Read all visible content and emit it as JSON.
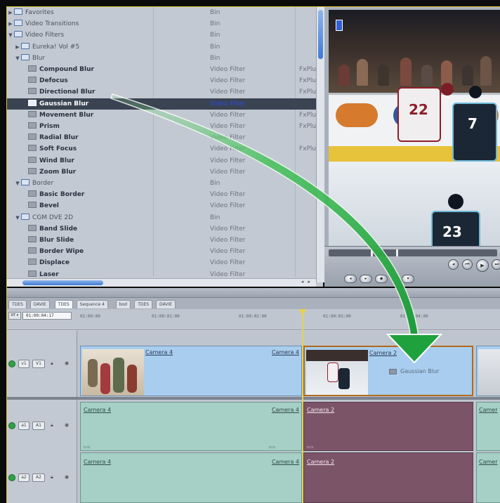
{
  "browser": {
    "rows": [
      {
        "kind": "bin",
        "indent": 1,
        "expanded": false,
        "name": "Favorites",
        "type": "Bin",
        "mfr": ""
      },
      {
        "kind": "bin",
        "indent": 1,
        "expanded": false,
        "name": "Video Transitions",
        "type": "Bin",
        "mfr": ""
      },
      {
        "kind": "bin",
        "indent": 1,
        "expanded": true,
        "name": "Video Filters",
        "type": "Bin",
        "mfr": ""
      },
      {
        "kind": "bin",
        "indent": 2,
        "expanded": false,
        "name": "Eureka! Vol #5",
        "type": "Bin",
        "mfr": ""
      },
      {
        "kind": "bin",
        "indent": 2,
        "expanded": true,
        "name": "Blur",
        "type": "Bin",
        "mfr": ""
      },
      {
        "kind": "filter",
        "indent": 3,
        "name": "Compound Blur",
        "type": "Video Filter",
        "mfr": "FxPlu"
      },
      {
        "kind": "filter",
        "indent": 3,
        "name": "Defocus",
        "type": "Video Filter",
        "mfr": "FxPlu"
      },
      {
        "kind": "filter",
        "indent": 3,
        "name": "Directional Blur",
        "type": "Video Filter",
        "mfr": "FxPlu"
      },
      {
        "kind": "filter",
        "indent": 3,
        "name": "Gaussian Blur",
        "type": "Video Filter",
        "mfr": "",
        "selected": true
      },
      {
        "kind": "filter",
        "indent": 3,
        "name": "Movement Blur",
        "type": "Video Filter",
        "mfr": "FxPlu"
      },
      {
        "kind": "filter",
        "indent": 3,
        "name": "Prism",
        "type": "Video Filter",
        "mfr": "FxPlu"
      },
      {
        "kind": "filter",
        "indent": 3,
        "name": "Radial Blur",
        "type": "Video Filter",
        "mfr": ""
      },
      {
        "kind": "filter",
        "indent": 3,
        "name": "Soft Focus",
        "type": "Video Filter",
        "mfr": "FxPlu"
      },
      {
        "kind": "filter",
        "indent": 3,
        "name": "Wind Blur",
        "type": "Video Filter",
        "mfr": ""
      },
      {
        "kind": "filter",
        "indent": 3,
        "name": "Zoom Blur",
        "type": "Video Filter",
        "mfr": ""
      },
      {
        "kind": "bin",
        "indent": 2,
        "expanded": true,
        "name": "Border",
        "type": "Bin",
        "mfr": ""
      },
      {
        "kind": "filter",
        "indent": 3,
        "name": "Basic Border",
        "type": "Video Filter",
        "mfr": ""
      },
      {
        "kind": "filter",
        "indent": 3,
        "name": "Bevel",
        "type": "Video Filter",
        "mfr": ""
      },
      {
        "kind": "bin",
        "indent": 2,
        "expanded": true,
        "name": "CGM DVE 2D",
        "type": "Bin",
        "mfr": ""
      },
      {
        "kind": "filter",
        "indent": 3,
        "name": "Band Slide",
        "type": "Video Filter",
        "mfr": ""
      },
      {
        "kind": "filter",
        "indent": 3,
        "name": "Blur Slide",
        "type": "Video Filter",
        "mfr": ""
      },
      {
        "kind": "filter",
        "indent": 3,
        "name": "Border Wipe",
        "type": "Video Filter",
        "mfr": ""
      },
      {
        "kind": "filter",
        "indent": 3,
        "name": "Displace",
        "type": "Video Filter",
        "mfr": ""
      },
      {
        "kind": "filter",
        "indent": 3,
        "name": "Laser",
        "type": "Video Filter",
        "mfr": ""
      }
    ]
  },
  "viewer": {
    "jersey_left": "22",
    "jersey_right": "7",
    "jersey_bottom": "23"
  },
  "timeline": {
    "tabs": [
      "TDES",
      "DAVIE",
      "TDES",
      "Sequence 4",
      "bod",
      "TDES",
      "DAVIE"
    ],
    "active_tab": 2,
    "timecode": "01:00:04:17",
    "ruler": [
      "01:00:00",
      "01:00:01:00",
      "01:00:02:00",
      "01:00:03:00",
      "01:00:04:00"
    ],
    "video_track": {
      "patch": "v1",
      "dest": "V1"
    },
    "audio_tracks": [
      {
        "patch": "a1",
        "dest": "A1"
      },
      {
        "patch": "a2",
        "dest": "A2"
      }
    ],
    "video_clips": [
      {
        "label": "Camera 4",
        "end_label": "Camera 4"
      },
      {
        "label": "Camera 2",
        "filter": "Gaussian Blur"
      },
      {
        "label": ""
      }
    ],
    "audio_row1": [
      {
        "label": "Camera 4",
        "end_label": "Camera 4"
      },
      {
        "label": "Camera 2"
      },
      {
        "label": "Camer"
      }
    ],
    "audio_row2": [
      {
        "label": "Camera 4",
        "end_label": "Camera 4"
      },
      {
        "label": "Camera 2"
      },
      {
        "label": "Camer"
      }
    ]
  }
}
